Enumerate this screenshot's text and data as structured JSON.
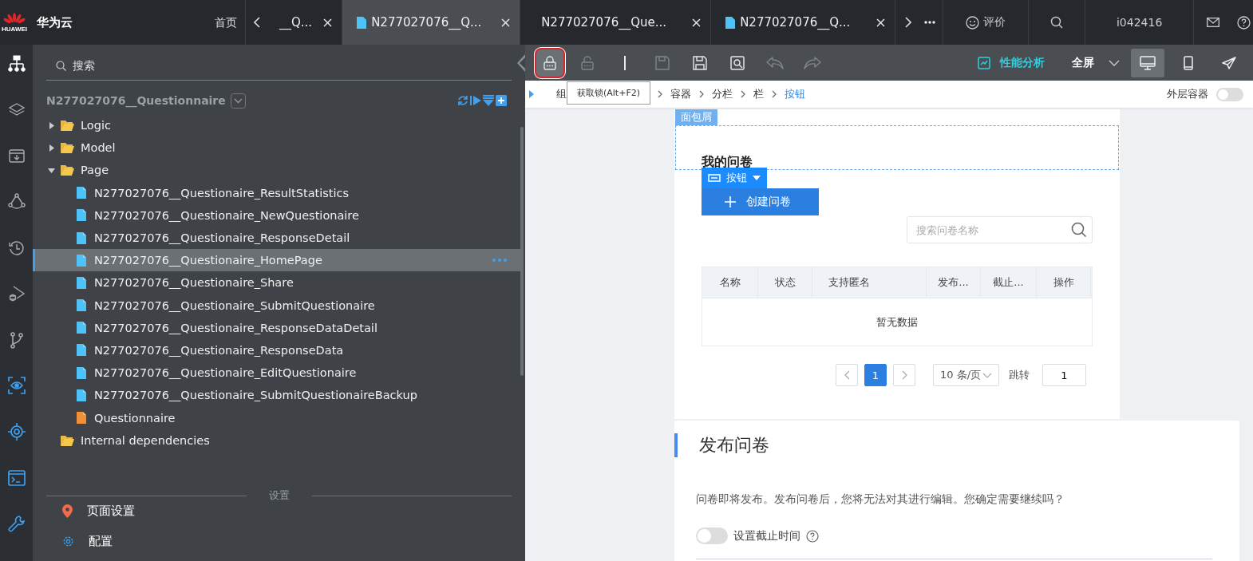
{
  "brand": {
    "logo_text": "HUAWEI",
    "name": "华为云"
  },
  "top_nav": {
    "home": "首页",
    "tabs": [
      {
        "label": "__Q...",
        "kind": "plain",
        "selected": false
      },
      {
        "label": "N277027076__Q...",
        "kind": "file",
        "selected": true
      },
      {
        "label": "N277027076__Que...",
        "kind": "plain",
        "selected": false
      },
      {
        "label": "N277027076__Q...",
        "kind": "file",
        "selected": false
      }
    ],
    "rate": "评价",
    "user": "i042416"
  },
  "sidebar": {
    "search_placeholder": "搜索",
    "project": "N277027076__Questionnaire",
    "tree": [
      {
        "label": "Logic",
        "kind": "folder",
        "expanded": false
      },
      {
        "label": "Model",
        "kind": "folder",
        "expanded": false
      },
      {
        "label": "Page",
        "kind": "folder",
        "expanded": true,
        "children": [
          {
            "label": "N277027076__Questionaire_ResultStatistics",
            "kind": "page",
            "selected": false
          },
          {
            "label": "N277027076__Questionaire_NewQuestionaire",
            "kind": "page",
            "selected": false
          },
          {
            "label": "N277027076__Questionaire_ResponseDetail",
            "kind": "page",
            "selected": false
          },
          {
            "label": "N277027076__Questionaire_HomePage",
            "kind": "page",
            "selected": true
          },
          {
            "label": "N277027076__Questionaire_Share",
            "kind": "page",
            "selected": false
          },
          {
            "label": "N277027076__Questionaire_SubmitQuestionaire",
            "kind": "page",
            "selected": false
          },
          {
            "label": "N277027076__Questionaire_ResponseDataDetail",
            "kind": "page",
            "selected": false
          },
          {
            "label": "N277027076__Questionaire_ResponseData",
            "kind": "page",
            "selected": false
          },
          {
            "label": "N277027076__Questionaire_EditQuestionaire",
            "kind": "page",
            "selected": false
          },
          {
            "label": "N277027076__Questionaire_SubmitQuestionaireBackup",
            "kind": "page",
            "selected": false
          },
          {
            "label": "Questionnaire",
            "kind": "model",
            "selected": false
          }
        ]
      },
      {
        "label": "Internal dependencies",
        "kind": "group"
      }
    ],
    "settings_heading": "设置",
    "settings": [
      {
        "label": "页面设置",
        "kind": "location"
      },
      {
        "label": "配置",
        "kind": "gear"
      }
    ]
  },
  "toolbar": {
    "tools": [
      {
        "kind": "lock",
        "disabled": false,
        "highlighted": true
      },
      {
        "kind": "unlock",
        "disabled": true,
        "highlighted": false
      },
      {
        "kind": "cursor",
        "disabled": false,
        "highlighted": false
      },
      {
        "kind": "save",
        "disabled": true,
        "highlighted": false
      },
      {
        "kind": "save-all",
        "disabled": false,
        "highlighted": false
      },
      {
        "kind": "preview",
        "disabled": false,
        "highlighted": false
      },
      {
        "kind": "undo",
        "disabled": true,
        "highlighted": false
      },
      {
        "kind": "redo",
        "disabled": true,
        "highlighted": false
      }
    ],
    "performance": "性能分析",
    "fullscreen": "全屏",
    "devices": [
      {
        "kind": "desktop",
        "selected": true
      },
      {
        "kind": "phone",
        "selected": false
      },
      {
        "kind": "send",
        "selected": false
      }
    ],
    "tooltip": "获取锁(Alt+F2)"
  },
  "breadcrumb": {
    "items": [
      {
        "label": "组",
        "selected": false
      },
      {
        "label": "容器",
        "selected": false
      },
      {
        "label": "分栏",
        "selected": false
      },
      {
        "label": "栏",
        "selected": false
      },
      {
        "label": "按钮",
        "selected": true
      }
    ],
    "outer_label": "外层容器",
    "outer_on": false
  },
  "preview": {
    "section_tag": "面包屑",
    "title": "我的问卷",
    "component_tag": "按钮",
    "create_button": "创建问卷",
    "search_placeholder": "搜索问卷名称",
    "table": {
      "columns": [
        "名称",
        "状态",
        "支持匿名",
        "发布...",
        "截止...",
        "操作"
      ],
      "empty": "暂无数据"
    },
    "pagination": {
      "pages": [
        {
          "label": "1",
          "selected": true
        }
      ],
      "page_size": "10 条/页",
      "jump_label": "跳转",
      "jump_value": "1"
    }
  },
  "dialog": {
    "title": "发布问卷",
    "message": "问卷即将发布。发布问卷后，您将无法对其进行编辑。您确定需要继续吗？",
    "toggle_label": "设置截止时间",
    "toggle_on": false
  }
}
